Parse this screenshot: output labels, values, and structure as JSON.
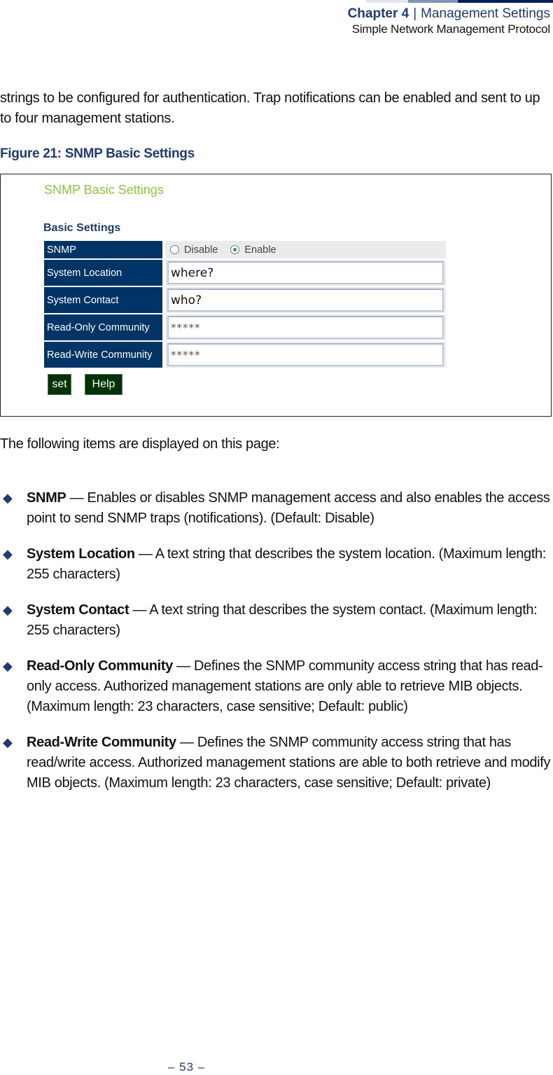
{
  "header": {
    "chapter": "Chapter 4",
    "separator": "|",
    "section": "Management Settings",
    "subsection": "Simple Network Management Protocol"
  },
  "intro_text": "strings to be configured for authentication. Trap notifications can be enabled and sent to up to four management stations.",
  "figure": {
    "caption": "Figure 21:  SNMP Basic Settings",
    "title": "SNMP Basic Settings",
    "subtitle": "Basic Settings",
    "rows": [
      {
        "label": "SNMP",
        "type": "radio",
        "options": [
          "Disable",
          "Enable"
        ],
        "selected": "Enable"
      },
      {
        "label": "System Location",
        "type": "text",
        "value": "where?"
      },
      {
        "label": "System Contact",
        "type": "text",
        "value": "who?"
      },
      {
        "label": "Read-Only Community",
        "type": "password",
        "value": "*****"
      },
      {
        "label": "Read-Write Community",
        "type": "password",
        "value": "*****"
      }
    ],
    "buttons": {
      "set": "set",
      "help": "Help"
    }
  },
  "lead_text": "The following items are displayed on this page:",
  "bullets": [
    {
      "term": "SNMP",
      "text": " — Enables or disables SNMP management access and also enables the access point to send SNMP traps (notifications). (Default: Disable)"
    },
    {
      "term": "System Location",
      "text": " — A text string that describes the system location. (Maximum length: 255 characters)"
    },
    {
      "term": "System Contact",
      "text": " — A text string that describes the system contact. (Maximum length: 255 characters)"
    },
    {
      "term": "Read-Only Community",
      "text": " — Defines the SNMP community access string that has read-only access. Authorized management stations are only able to retrieve MIB objects. (Maximum length: 23 characters, case sensitive; Default: public)"
    },
    {
      "term": "Read-Write Community",
      "text": " — Defines the SNMP community access string that has read/write access. Authorized management stations are able to both retrieve and modify MIB objects. (Maximum length: 23 characters, case sensitive; Default: private)"
    }
  ],
  "bullet_glyph": "◆",
  "page_number": "–  53  –"
}
